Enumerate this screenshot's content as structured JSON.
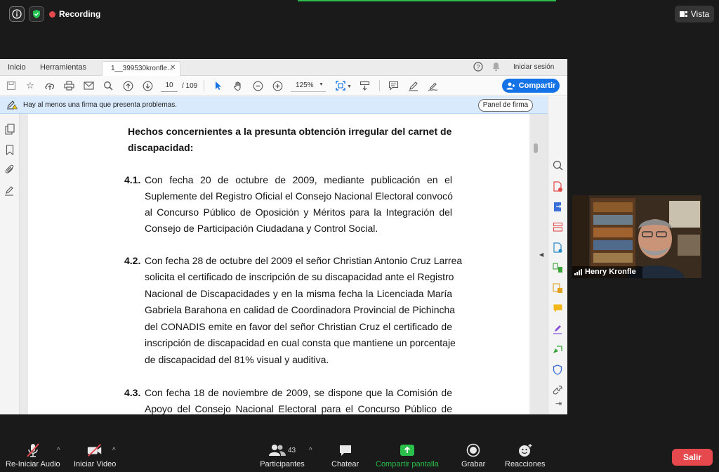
{
  "zoom_top": {
    "recording_label": "Recording",
    "view_button_label": "Vista"
  },
  "acrobat": {
    "tabs": {
      "home": "Inicio",
      "tools": "Herramientas",
      "document": "1__399530kronfle..."
    },
    "signin_label": "Iniciar sesión",
    "current_page": "10",
    "page_total": "/ 109",
    "zoom_level": "125%",
    "share_label": "Compartir",
    "signature_message": "Hay al menos una firma que presenta problemas.",
    "signature_panel_label": "Panel de firma"
  },
  "document": {
    "heading_line1": "Hechos concernientes a la presunta obtención irregular del carnet de",
    "heading_line2": "discapacidad:",
    "p1": {
      "number": "4.1.",
      "lines": [
        "Con fecha 20 de octubre de 2009, mediante publicación en el",
        "Suplemente del Registro Oficial el Consejo Nacional Electoral convocó",
        "al Concurso Público de Oposición y Méritos para la Integración del",
        "Consejo de Participación Ciudadana y Control Social."
      ]
    },
    "p2": {
      "number": "4.2.",
      "lines": [
        "Con fecha 28 de octubre del 2009 el señor Christian Antonio Cruz Larrea",
        "solicita el certificado de inscripción de su discapacidad ante el Registro",
        "Nacional de Discapacidades y en la misma fecha la Licenciada María",
        "Gabriela Barahona en calidad de Coordinadora Provincial de Pichincha",
        "del CONADIS emite en favor del señor Christian Cruz el certificado de",
        "inscripción de discapacidad en cual consta que mantiene un porcentaje",
        "de discapacidad del 81% visual y auditiva."
      ]
    },
    "p3": {
      "number": "4.3.",
      "lines": [
        "Con fecha 18 de noviembre de 2009, se dispone que la Comisión de",
        "Apoyo del Consejo Nacional Electoral para el Concurso Público de"
      ]
    }
  },
  "participant": {
    "name": "Henry Kronfle"
  },
  "bottom_bar": {
    "audio": "Re-Iniciar Audio",
    "video": "Iniciar Video",
    "participants": "Participantes",
    "participant_count": "43",
    "chat": "Chatear",
    "share": "Compartir pantalla",
    "record": "Grabar",
    "reactions": "Reacciones",
    "leave": "Salir"
  },
  "colors": {
    "accent_blue": "#1473e6",
    "share_green": "#2bbf4b",
    "leave_red": "#e5484d"
  }
}
